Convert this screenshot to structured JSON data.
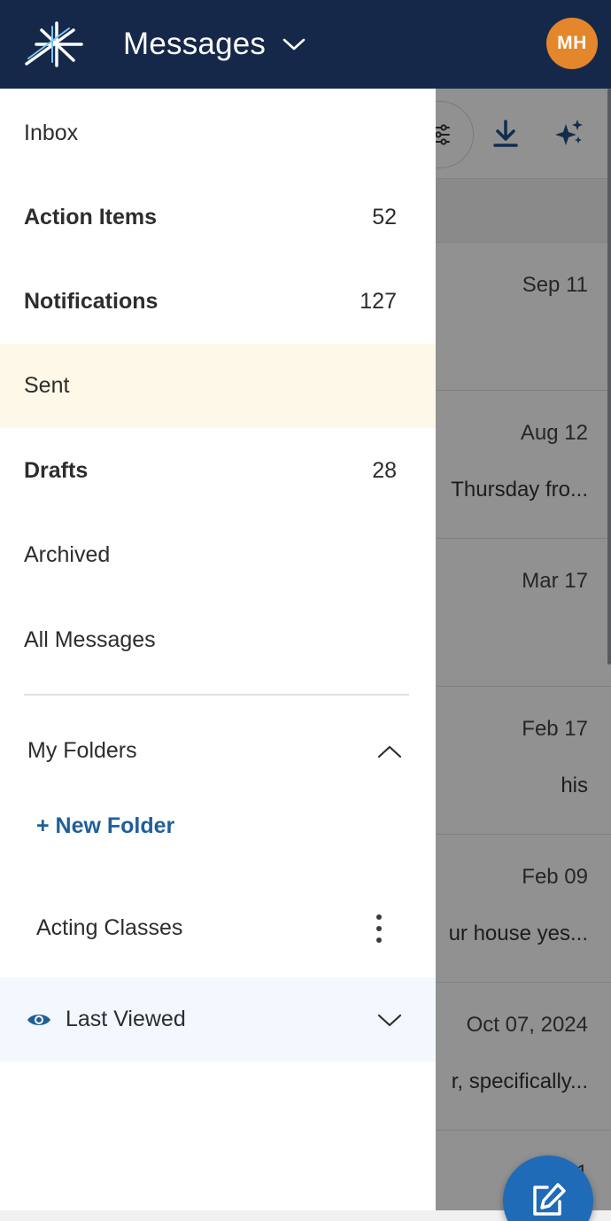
{
  "header": {
    "title": "Messages",
    "avatar_initials": "MH",
    "avatar_color": "#e4862b",
    "bar_color": "#16284a"
  },
  "background_list": {
    "rows": [
      {
        "date": "Sep 11",
        "snippet": ""
      },
      {
        "date": "Aug 12",
        "snippet": "Thursday fro..."
      },
      {
        "date": "Mar 17",
        "snippet": ""
      },
      {
        "date": "Feb 17",
        "snippet": "his"
      },
      {
        "date": "Feb 09",
        "snippet": "ur house yes..."
      },
      {
        "date": "Oct 07, 2024",
        "snippet": "r, specifically..."
      },
      {
        "date": "Jan 1",
        "snippet": ""
      }
    ]
  },
  "drawer": {
    "items": [
      {
        "label": "Inbox",
        "count": ""
      },
      {
        "label": "Action Items",
        "count": "52"
      },
      {
        "label": "Notifications",
        "count": "127"
      },
      {
        "label": "Sent",
        "count": ""
      },
      {
        "label": "Drafts",
        "count": "28"
      },
      {
        "label": "Archived",
        "count": ""
      },
      {
        "label": "All Messages",
        "count": ""
      }
    ],
    "folders_title": "My Folders",
    "new_folder_label": "+ New Folder",
    "folders": [
      {
        "label": "Acting Classes"
      }
    ],
    "last_viewed_label": "Last Viewed",
    "active_color": "#fdf8e7",
    "accent_color": "#1f5f99"
  },
  "icons": {
    "logo": "asterisk-logo-icon",
    "title_dropdown": "chevron-down-icon",
    "filter": "sliders-icon",
    "download": "download-icon",
    "sparkle": "sparkle-icon",
    "compose": "compose-icon",
    "folders_toggle": "chevron-up-icon",
    "folder_menu": "kebab-icon",
    "last_viewed": "eye-icon",
    "last_viewed_toggle": "chevron-down-icon"
  }
}
